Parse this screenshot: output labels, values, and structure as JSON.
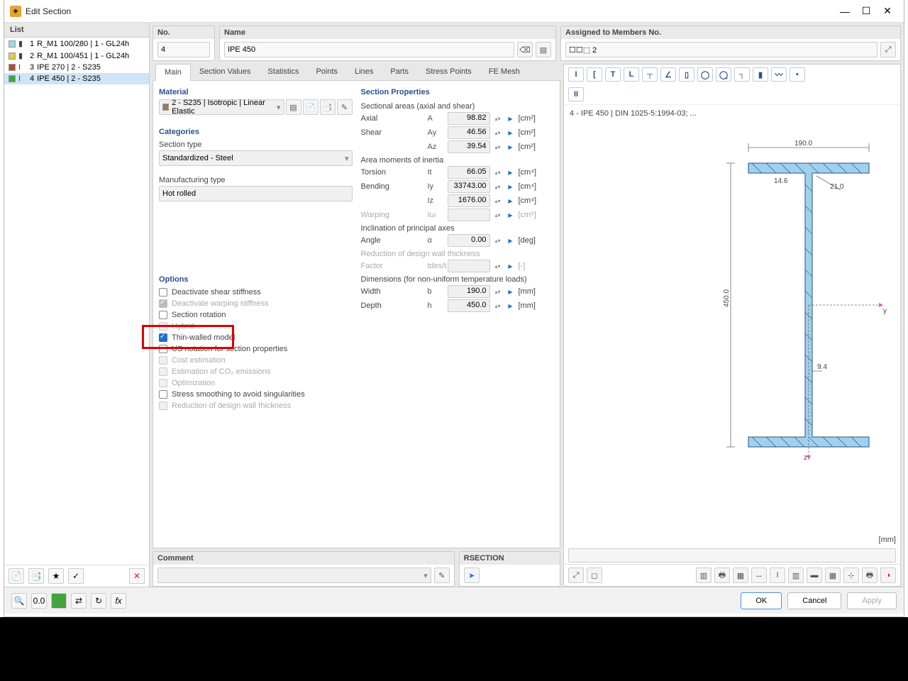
{
  "window_title": "Edit Section",
  "titlebar": {
    "min": "—",
    "max": "☐",
    "close": "✕"
  },
  "left_panel": {
    "header": "List",
    "items": [
      {
        "color": "#9ed9e6",
        "num": "1",
        "label": "R_M1 100/280 | 1 - GL24h",
        "icon": "▮"
      },
      {
        "color": "#e6c94a",
        "num": "2",
        "label": "R_M1 100/451 | 1 - GL24h",
        "icon": "▮"
      },
      {
        "color": "#b64a39",
        "num": "3",
        "label": "IPE 270 | 2 - S235",
        "icon": "I"
      },
      {
        "color": "#41a43e",
        "num": "4",
        "label": "IPE 450 | 2 - S235",
        "icon": "I",
        "selected": true
      }
    ]
  },
  "top": {
    "no_label": "No.",
    "no_value": "4",
    "name_label": "Name",
    "name_value": "IPE 450",
    "assign_label": "Assigned to Members No.",
    "assign_value": "☐☐⬚ 2"
  },
  "tabs": [
    "Main",
    "Section Values",
    "Statistics",
    "Points",
    "Lines",
    "Parts",
    "Stress Points",
    "FE Mesh"
  ],
  "material": {
    "header": "Material",
    "value": "2 - S235 | Isotropic | Linear Elastic",
    "swatch": "#9c7a55"
  },
  "categories": {
    "header": "Categories",
    "sect_type_lbl": "Section type",
    "sect_type_val": "Standardized - Steel",
    "manu_lbl": "Manufacturing type",
    "manu_val": "Hot rolled"
  },
  "options": {
    "header": "Options",
    "items": [
      {
        "label": "Deactivate shear stiffness",
        "state": "unchecked",
        "enabled": true
      },
      {
        "label": "Deactivate warping stiffness",
        "state": "checked",
        "enabled": false
      },
      {
        "label": "Section rotation",
        "state": "unchecked",
        "enabled": true
      },
      {
        "label": "Hybrid...",
        "state": "unchecked",
        "enabled": false
      },
      {
        "label": "Thin-walled model",
        "state": "checked",
        "enabled": true,
        "highlighted": true
      },
      {
        "label": "US notation for section properties",
        "state": "unchecked",
        "enabled": true
      },
      {
        "label": "Cost estimation",
        "state": "unchecked",
        "enabled": false
      },
      {
        "label": "Estimation of CO₂ emissions",
        "state": "unchecked",
        "enabled": false
      },
      {
        "label": "Optimization",
        "state": "unchecked",
        "enabled": false
      },
      {
        "label": "Stress smoothing to avoid singularities",
        "state": "unchecked",
        "enabled": true
      },
      {
        "label": "Reduction of design wall thickness",
        "state": "unchecked",
        "enabled": false
      }
    ]
  },
  "props": {
    "header": "Section Properties",
    "groups": [
      {
        "title": "Sectional areas (axial and shear)",
        "rows": [
          {
            "label": "Axial",
            "sym": "A",
            "val": "98.82",
            "unit": "[cm²]"
          },
          {
            "label": "Shear",
            "sym": "Ay",
            "val": "46.56",
            "unit": "[cm²]"
          },
          {
            "label": "",
            "sym": "Az",
            "val": "39.54",
            "unit": "[cm²]"
          }
        ]
      },
      {
        "title": "Area moments of inertia",
        "rows": [
          {
            "label": "Torsion",
            "sym": "It",
            "val": "66.05",
            "unit": "[cm⁴]"
          },
          {
            "label": "Bending",
            "sym": "Iy",
            "val": "33743.00",
            "unit": "[cm⁴]"
          },
          {
            "label": "",
            "sym": "Iz",
            "val": "1676.00",
            "unit": "[cm⁴]"
          },
          {
            "label": "Warping",
            "sym": "Iω",
            "val": "",
            "unit": "[cm⁶]",
            "disabled": true
          }
        ]
      },
      {
        "title": "Inclination of principal axes",
        "rows": [
          {
            "label": "Angle",
            "sym": "α",
            "val": "0.00",
            "unit": "[deg]"
          }
        ]
      },
      {
        "title": "Reduction of design wall thickness",
        "disabled": true,
        "rows": [
          {
            "label": "Factor",
            "sym": "tdes/t",
            "val": "",
            "unit": "[-]",
            "disabled": true
          }
        ]
      },
      {
        "title": "Dimensions (for non-uniform temperature loads)",
        "rows": [
          {
            "label": "Width",
            "sym": "b",
            "val": "190.0",
            "unit": "[mm]"
          },
          {
            "label": "Depth",
            "sym": "h",
            "val": "450.0",
            "unit": "[mm]"
          }
        ]
      }
    ]
  },
  "comment": {
    "header": "Comment",
    "rsection": "RSECTION"
  },
  "preview": {
    "shape_icons": [
      "I",
      "[",
      "T",
      "L",
      "┬",
      "∠",
      "▯",
      "◯",
      "◯̱",
      "┐",
      "▮",
      "〰",
      "▪"
    ],
    "title": "4 - IPE 450 | DIN 1025-5:1994-03; ...",
    "dims": {
      "width": "190.0",
      "height": "450.0",
      "tf": "14.6",
      "tw": "9.4",
      "r": "21.0"
    },
    "unit": "[mm]",
    "axis_y": "y",
    "axis_z": "z"
  },
  "footer": {
    "ok": "OK",
    "cancel": "Cancel",
    "apply": "Apply"
  }
}
